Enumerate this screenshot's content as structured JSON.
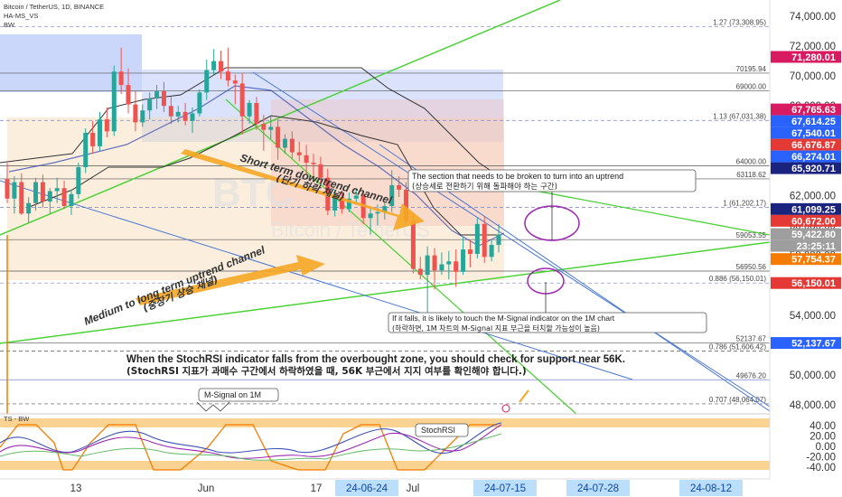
{
  "header": {
    "symbol_line": "Bitcoin / TetherUS, 1D, BINANCE",
    "indicator_1": "HA-MS_VS",
    "indicator_2": "BW"
  },
  "colors": {
    "bull_candle": "#26a69a",
    "bear_candle": "#ef5350",
    "channel_green": "#4cd137",
    "downtrend_blue": "#4a77d4",
    "tag_red": "#e53935",
    "tag_blue": "#2962ff",
    "tag_darkblue": "#1a237e",
    "tag_magenta": "#d81b60",
    "tag_orange": "#f57c00",
    "tag_gray": "#9e9e9e",
    "annotation_orange": "#f5a623",
    "annotation_purple": "#9c27b0"
  },
  "price_axis": {
    "ticks": [
      "74,000.00",
      "72,000.00",
      "70,000.00",
      "68,000.00",
      "64,000.00",
      "62,000.00",
      "60,000.00",
      "58,000.00",
      "54,000.00",
      "50,000.00",
      "48,000.00"
    ],
    "tags": [
      {
        "value": "71,280.01",
        "color": "#d81b60"
      },
      {
        "value": "67,765.63",
        "color": "#d81b60"
      },
      {
        "value": "67,614.25",
        "color": "#2962ff"
      },
      {
        "value": "67,540.01",
        "color": "#2962ff"
      },
      {
        "value": "66,676.87",
        "color": "#e53935"
      },
      {
        "value": "66,274.01",
        "color": "#2962ff"
      },
      {
        "value": "65,920.71",
        "color": "#1a237e"
      },
      {
        "value": "61,099.25",
        "color": "#1a237e"
      },
      {
        "value": "60,672.00",
        "color": "#e53935"
      },
      {
        "value": "59,422.80",
        "color": "#9e9e9e"
      },
      {
        "value": "23:25:11",
        "color": "#9e9e9e"
      },
      {
        "value": "57,754.37",
        "color": "#f57c00"
      },
      {
        "value": "56,150.01",
        "color": "#e53935"
      },
      {
        "value": "52,137.67",
        "color": "#2962ff"
      }
    ]
  },
  "level_labels": [
    {
      "text": "1.27 (73,308.95)",
      "value": 73308.95
    },
    {
      "text": "70195.94",
      "value": 70195.94
    },
    {
      "text": "69000.00",
      "value": 69000
    },
    {
      "text": "1.13 (67,031.38)",
      "value": 67031.38
    },
    {
      "text": "64000.00",
      "value": 64000
    },
    {
      "text": "63118.62",
      "value": 63118.62
    },
    {
      "text": "1 (61,202.17)",
      "value": 61202.17
    },
    {
      "text": "59053.55",
      "value": 59053.55
    },
    {
      "text": "56950.56",
      "value": 56950.56
    },
    {
      "text": "0.886 (56,150.01)",
      "value": 56150.01
    },
    {
      "text": "52137.67",
      "value": 52137.67
    },
    {
      "text": "0.786 (51,606.42)",
      "value": 51606.42
    },
    {
      "text": "49676.20",
      "value": 49676.2
    },
    {
      "text": "0.707 (48,064.07)",
      "value": 48064.07
    }
  ],
  "annotations": {
    "short_term_en": "Short term downtrend channel",
    "short_term_ko": "(단기 하락 채널)",
    "medium_term_en": "Medium to long term uptrend channel",
    "medium_term_ko": "(중장기 상승 채널)",
    "break_en": "The section that needs to be broken to turn into an uptrend",
    "break_ko": "(상승세로 전환하기 위해 돌파해야 하는 구간)",
    "fall_en": "If it falls, it is likely to touch the M-Signal indicator on the 1M chart",
    "fall_ko": "(하락하면, 1M 차트의 M-Signal 지표 부근을 터치할 가능성이 높음)",
    "stochrsi_en": "When the StochRSI indicator falls from the overbought zone, you should check for support near 56K.",
    "stochrsi_ko": "(StochRSI 지표가 과매수 구간에서 하락하였을 때, 56K 부근에서 지지 여부를 확인해야 합니다.)",
    "msignal_label": "M-Signal on 1M",
    "stochrsi_label": "StochRSI",
    "watermark": "BTC",
    "watermark_sub": "Bitcoin / TetherUS"
  },
  "oscillator": {
    "title": "TS - BW",
    "ticks": [
      "40.00",
      "20.00",
      "0.00",
      "-20.00",
      "-40.00"
    ]
  },
  "time_axis": {
    "labels": [
      "13",
      "Jun",
      "17",
      "Jul"
    ],
    "highlighted": [
      "24-06-24",
      "24-07-15",
      "24-07-28",
      "24-08-12"
    ]
  },
  "chart_data": {
    "type": "candlestick",
    "title": "Bitcoin / TetherUS, 1D, BINANCE",
    "ylim": [
      47000,
      75500
    ],
    "x_range": [
      "2024-05-08",
      "2024-08-20"
    ],
    "last_price": 59422.8,
    "candles": [
      {
        "o": 63100,
        "h": 64200,
        "l": 61500,
        "c": 61800
      },
      {
        "o": 61800,
        "h": 63300,
        "l": 60800,
        "c": 62900
      },
      {
        "o": 62900,
        "h": 63500,
        "l": 60700,
        "c": 60800
      },
      {
        "o": 60800,
        "h": 61900,
        "l": 60200,
        "c": 61500
      },
      {
        "o": 61500,
        "h": 63200,
        "l": 61000,
        "c": 62900
      },
      {
        "o": 62900,
        "h": 63400,
        "l": 61200,
        "c": 61600
      },
      {
        "o": 61600,
        "h": 62500,
        "l": 60800,
        "c": 62300
      },
      {
        "o": 62300,
        "h": 63200,
        "l": 61500,
        "c": 62500
      },
      {
        "o": 62500,
        "h": 63000,
        "l": 61100,
        "c": 61300
      },
      {
        "o": 61300,
        "h": 62400,
        "l": 60700,
        "c": 62100
      },
      {
        "o": 62100,
        "h": 64200,
        "l": 61800,
        "c": 63900
      },
      {
        "o": 63900,
        "h": 66500,
        "l": 63500,
        "c": 66200
      },
      {
        "o": 66200,
        "h": 67000,
        "l": 64800,
        "c": 65300
      },
      {
        "o": 65300,
        "h": 67600,
        "l": 65000,
        "c": 67100
      },
      {
        "o": 67100,
        "h": 67900,
        "l": 65900,
        "c": 66300
      },
      {
        "o": 66300,
        "h": 70700,
        "l": 66000,
        "c": 70300
      },
      {
        "o": 70300,
        "h": 71900,
        "l": 68800,
        "c": 69400
      },
      {
        "o": 69400,
        "h": 70500,
        "l": 67500,
        "c": 68100
      },
      {
        "o": 68100,
        "h": 69000,
        "l": 66300,
        "c": 66900
      },
      {
        "o": 66900,
        "h": 68100,
        "l": 66600,
        "c": 67700
      },
      {
        "o": 67700,
        "h": 68900,
        "l": 67100,
        "c": 68500
      },
      {
        "o": 68500,
        "h": 69400,
        "l": 67800,
        "c": 69000
      },
      {
        "o": 69000,
        "h": 69600,
        "l": 67600,
        "c": 68000
      },
      {
        "o": 68000,
        "h": 68600,
        "l": 66800,
        "c": 67300
      },
      {
        "o": 67300,
        "h": 68000,
        "l": 66900,
        "c": 67600
      },
      {
        "o": 67600,
        "h": 68200,
        "l": 66700,
        "c": 67000
      },
      {
        "o": 67000,
        "h": 67900,
        "l": 66200,
        "c": 67500
      },
      {
        "o": 67500,
        "h": 69100,
        "l": 67300,
        "c": 68900
      },
      {
        "o": 68900,
        "h": 71100,
        "l": 68400,
        "c": 70400
      },
      {
        "o": 70400,
        "h": 71800,
        "l": 70100,
        "c": 71000
      },
      {
        "o": 71000,
        "h": 71700,
        "l": 69800,
        "c": 70300
      },
      {
        "o": 70300,
        "h": 71900,
        "l": 69300,
        "c": 69700
      },
      {
        "o": 69700,
        "h": 70100,
        "l": 68100,
        "c": 69500
      },
      {
        "o": 69500,
        "h": 70200,
        "l": 66100,
        "c": 67300
      },
      {
        "o": 67300,
        "h": 68400,
        "l": 66800,
        "c": 68200
      },
      {
        "o": 68200,
        "h": 68600,
        "l": 66400,
        "c": 66800
      },
      {
        "o": 66800,
        "h": 67400,
        "l": 65000,
        "c": 66400
      },
      {
        "o": 66400,
        "h": 67300,
        "l": 65800,
        "c": 66600
      },
      {
        "o": 66600,
        "h": 67100,
        "l": 64400,
        "c": 65200
      },
      {
        "o": 65200,
        "h": 66100,
        "l": 64800,
        "c": 65800
      },
      {
        "o": 65800,
        "h": 66300,
        "l": 64500,
        "c": 64900
      },
      {
        "o": 64900,
        "h": 65600,
        "l": 64300,
        "c": 64700
      },
      {
        "o": 64700,
        "h": 65400,
        "l": 63400,
        "c": 64200
      },
      {
        "o": 64200,
        "h": 64800,
        "l": 63200,
        "c": 64100
      },
      {
        "o": 64100,
        "h": 64600,
        "l": 62900,
        "c": 63200
      },
      {
        "o": 63200,
        "h": 63800,
        "l": 60700,
        "c": 61000
      },
      {
        "o": 61000,
        "h": 62400,
        "l": 60600,
        "c": 61900
      },
      {
        "o": 61900,
        "h": 62300,
        "l": 60800,
        "c": 61100
      },
      {
        "o": 61100,
        "h": 62200,
        "l": 60900,
        "c": 61800
      },
      {
        "o": 61800,
        "h": 62500,
        "l": 61400,
        "c": 62000
      },
      {
        "o": 62000,
        "h": 62300,
        "l": 60100,
        "c": 60500
      },
      {
        "o": 60500,
        "h": 61200,
        "l": 59400,
        "c": 60800
      },
      {
        "o": 60800,
        "h": 61400,
        "l": 60000,
        "c": 60900
      },
      {
        "o": 60900,
        "h": 61500,
        "l": 60400,
        "c": 61300
      },
      {
        "o": 61300,
        "h": 63700,
        "l": 60900,
        "c": 62700
      },
      {
        "o": 62700,
        "h": 63300,
        "l": 61900,
        "c": 62400
      },
      {
        "o": 62400,
        "h": 62900,
        "l": 60100,
        "c": 60300
      },
      {
        "o": 60300,
        "h": 60800,
        "l": 56800,
        "c": 57100
      },
      {
        "o": 57100,
        "h": 57900,
        "l": 56400,
        "c": 56700
      },
      {
        "o": 56700,
        "h": 58600,
        "l": 53500,
        "c": 58000
      },
      {
        "o": 58000,
        "h": 58500,
        "l": 55700,
        "c": 57000
      },
      {
        "o": 57000,
        "h": 58200,
        "l": 56700,
        "c": 57400
      },
      {
        "o": 57400,
        "h": 58300,
        "l": 56400,
        "c": 57600
      },
      {
        "o": 57600,
        "h": 58400,
        "l": 55900,
        "c": 56900
      },
      {
        "o": 56900,
        "h": 59200,
        "l": 56700,
        "c": 58400
      },
      {
        "o": 58400,
        "h": 59000,
        "l": 57200,
        "c": 58100
      },
      {
        "o": 58100,
        "h": 60500,
        "l": 57800,
        "c": 60100
      },
      {
        "o": 60100,
        "h": 60600,
        "l": 57500,
        "c": 57900
      },
      {
        "o": 57900,
        "h": 59000,
        "l": 57600,
        "c": 58700
      },
      {
        "o": 58700,
        "h": 60100,
        "l": 58200,
        "c": 59400
      }
    ]
  }
}
